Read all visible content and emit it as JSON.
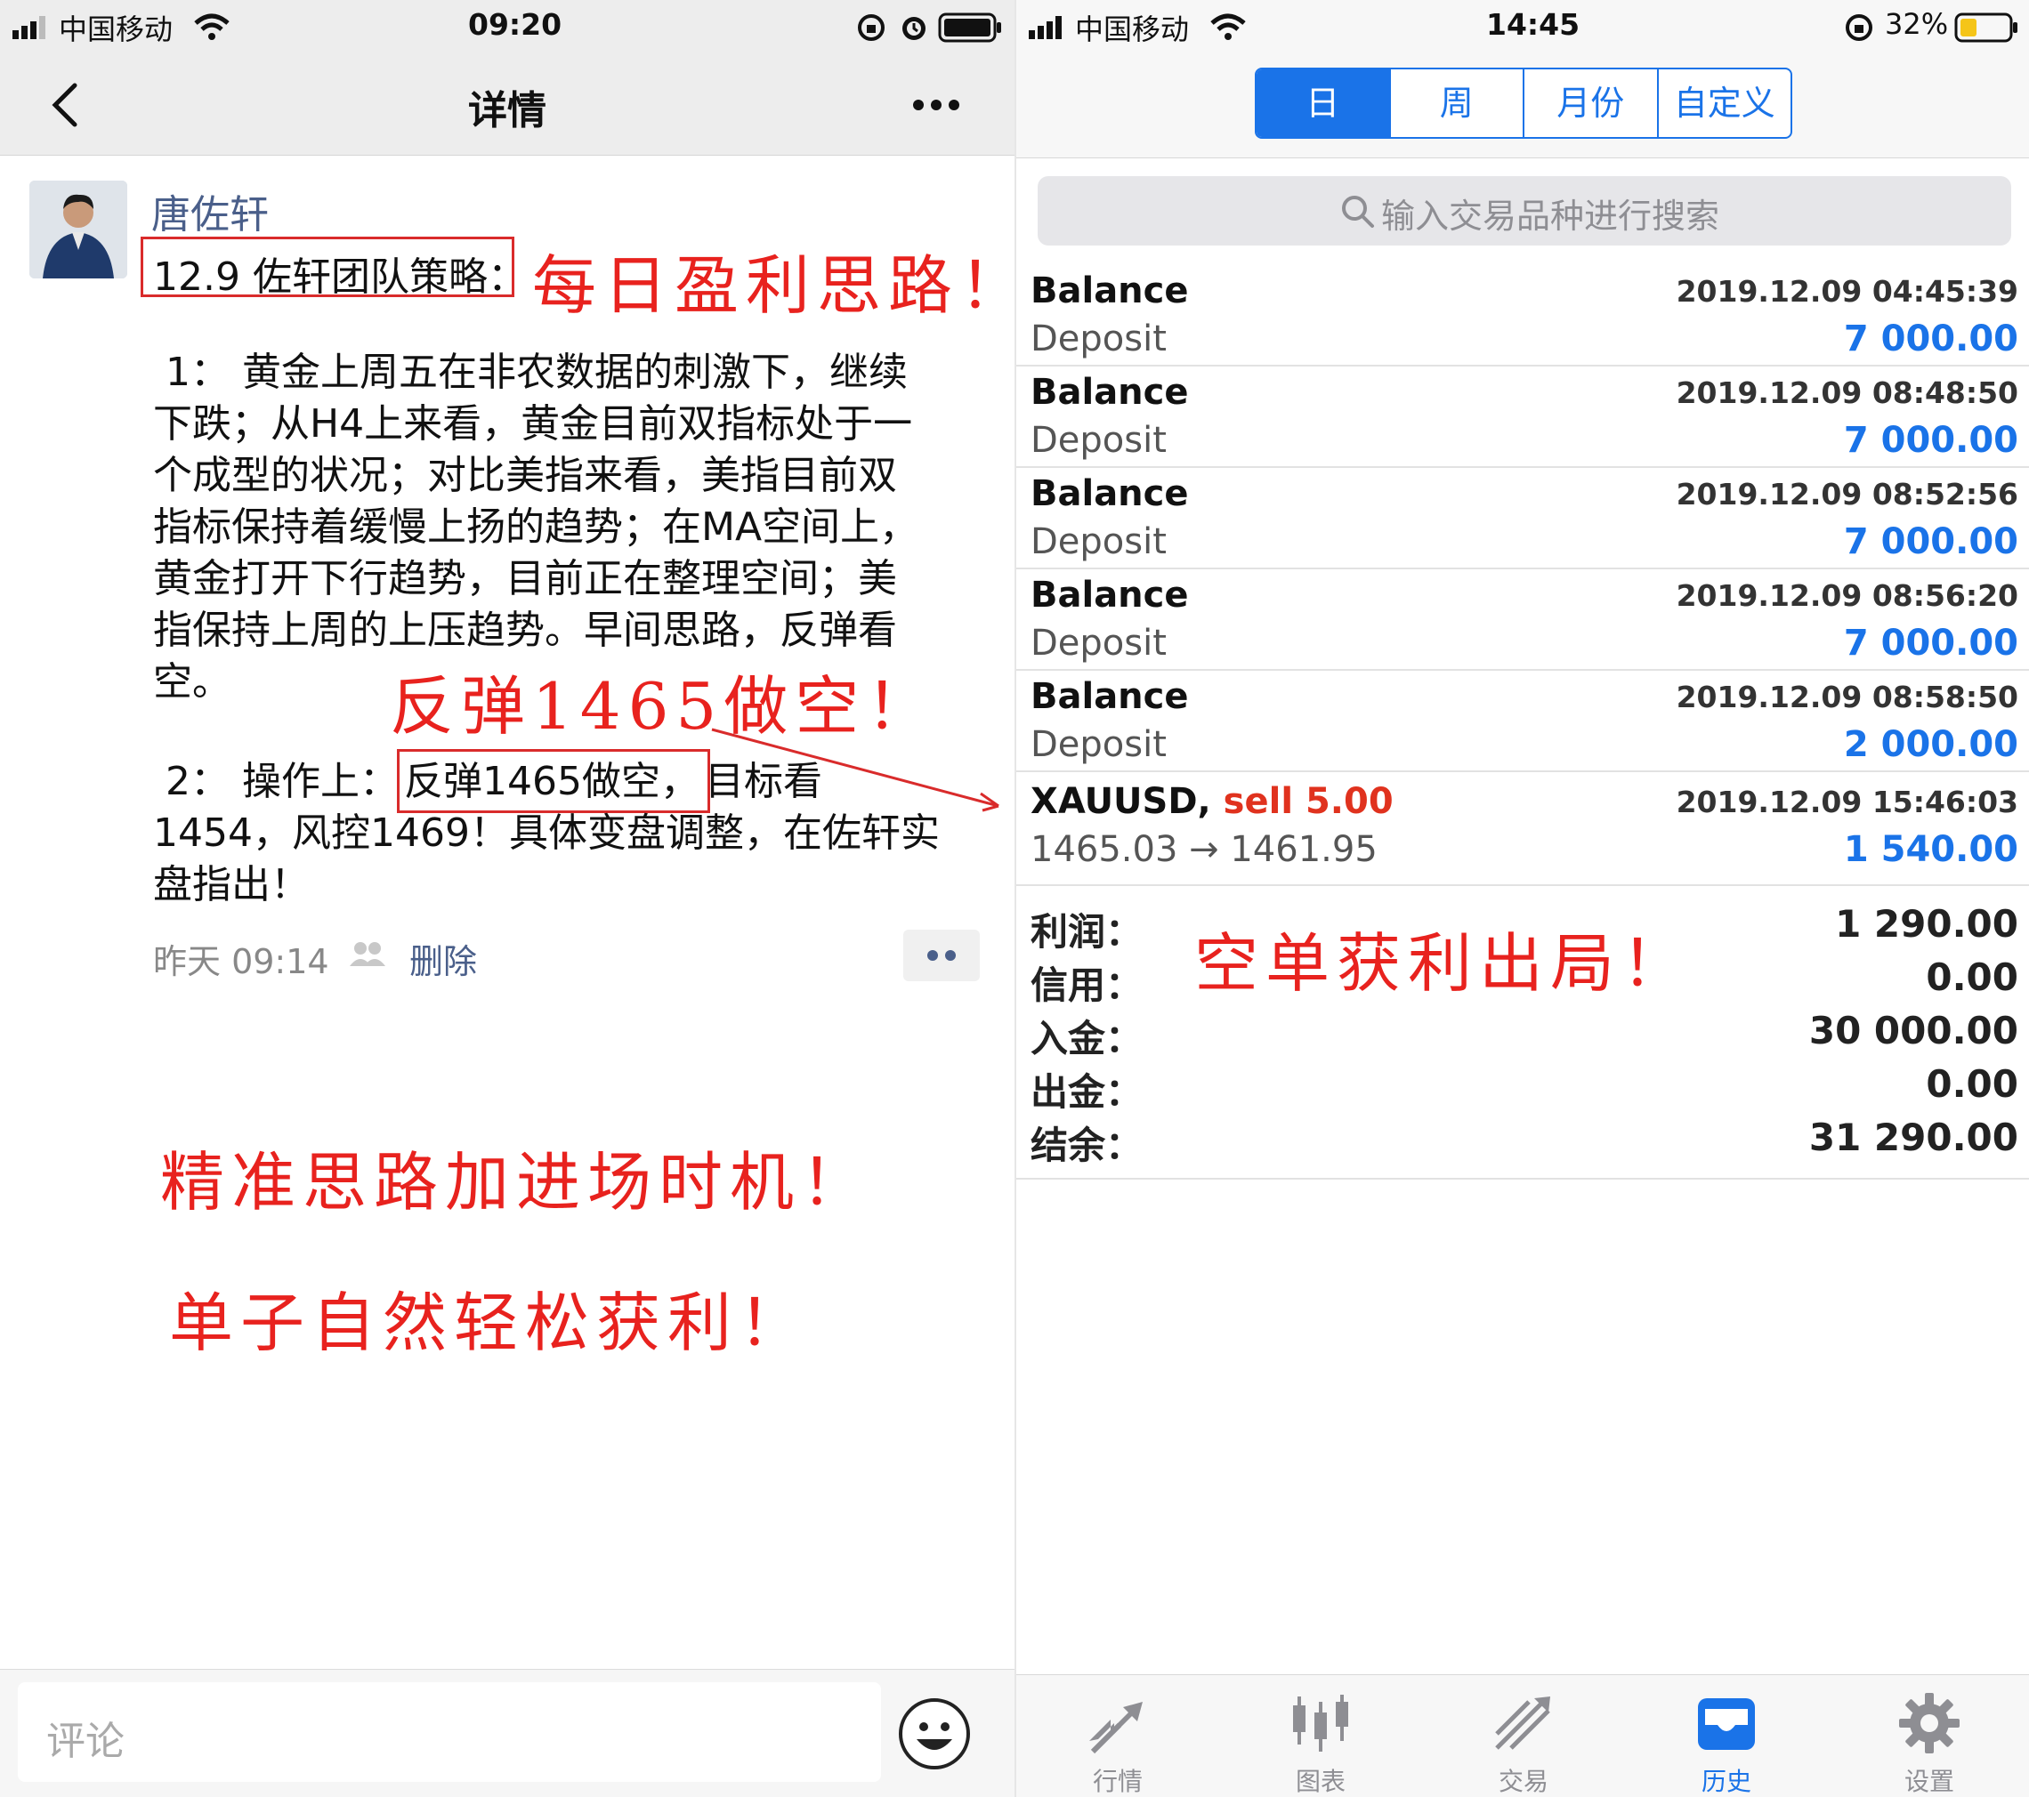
{
  "left": {
    "status": {
      "carrier": "中国移动",
      "time": "09:20"
    },
    "nav": {
      "title": "详情"
    },
    "post": {
      "author": "唐佐轩",
      "title": "12.9 佐轩团队策略：",
      "para1_lines": [
        " 1： 黄金上周五在非农数据的刺激下，继续",
        "下跌；从H4上来看，黄金目前双指标处于一",
        "个成型的状况；对比美指来看，美指目前双",
        "指标保持着缓慢上扬的趋势；在MA空间上，",
        "黄金打开下行趋势，目前正在整理空间；美",
        "指保持上周的上压趋势。早间思路，反弹看",
        "空。"
      ],
      "para2_prefix": " 2： 操作上：",
      "para2_boxed": "反弹1465做空，",
      "para2_suffix": "目标看",
      "para2_lines": [
        "1454，风控1469！具体变盘调整，在佐轩实",
        "盘指出！"
      ],
      "time": "昨天 09:14",
      "delete_label": "删除",
      "comment_placeholder": "评论"
    },
    "annotations": {
      "daily": "每日盈利思路！",
      "rebound": "反弹1465做空！",
      "precise": "精准思路加进场时机！",
      "profit": "单子自然轻松获利！"
    }
  },
  "right": {
    "status": {
      "carrier": "中国移动",
      "time": "14:45",
      "battery": "32%"
    },
    "segments": [
      "日",
      "周",
      "月份",
      "自定义"
    ],
    "search_placeholder": "输入交易品种进行搜索",
    "transactions": [
      {
        "name": "Balance",
        "date": "2019.12.09 04:45:39",
        "sub": "Deposit",
        "amount": "7 000.00"
      },
      {
        "name": "Balance",
        "date": "2019.12.09 08:48:50",
        "sub": "Deposit",
        "amount": "7 000.00"
      },
      {
        "name": "Balance",
        "date": "2019.12.09 08:52:56",
        "sub": "Deposit",
        "amount": "7 000.00"
      },
      {
        "name": "Balance",
        "date": "2019.12.09 08:56:20",
        "sub": "Deposit",
        "amount": "7 000.00"
      },
      {
        "name": "Balance",
        "date": "2019.12.09 08:58:50",
        "sub": "Deposit",
        "amount": "2 000.00"
      }
    ],
    "trade": {
      "symbol": "XAUUSD,",
      "action": "sell 5.00",
      "date": "2019.12.09 15:46:03",
      "prices": "1465.03 → 1461.95",
      "profit": "1 540.00"
    },
    "summary": [
      {
        "label": "利润：",
        "value": "1 290.00"
      },
      {
        "label": "信用：",
        "value": "0.00"
      },
      {
        "label": "入金：",
        "value": "30 000.00"
      },
      {
        "label": "出金：",
        "value": "0.00"
      },
      {
        "label": "结余：",
        "value": "31 290.00"
      }
    ],
    "annotation": "空单获利出局！",
    "tabs": [
      "行情",
      "图表",
      "交易",
      "历史",
      "设置"
    ]
  },
  "colors": {
    "accent": "#1a73e8",
    "annotation_red": "#e8221e",
    "sell_red": "#e0321e",
    "author_blue": "#4a5f8a"
  }
}
